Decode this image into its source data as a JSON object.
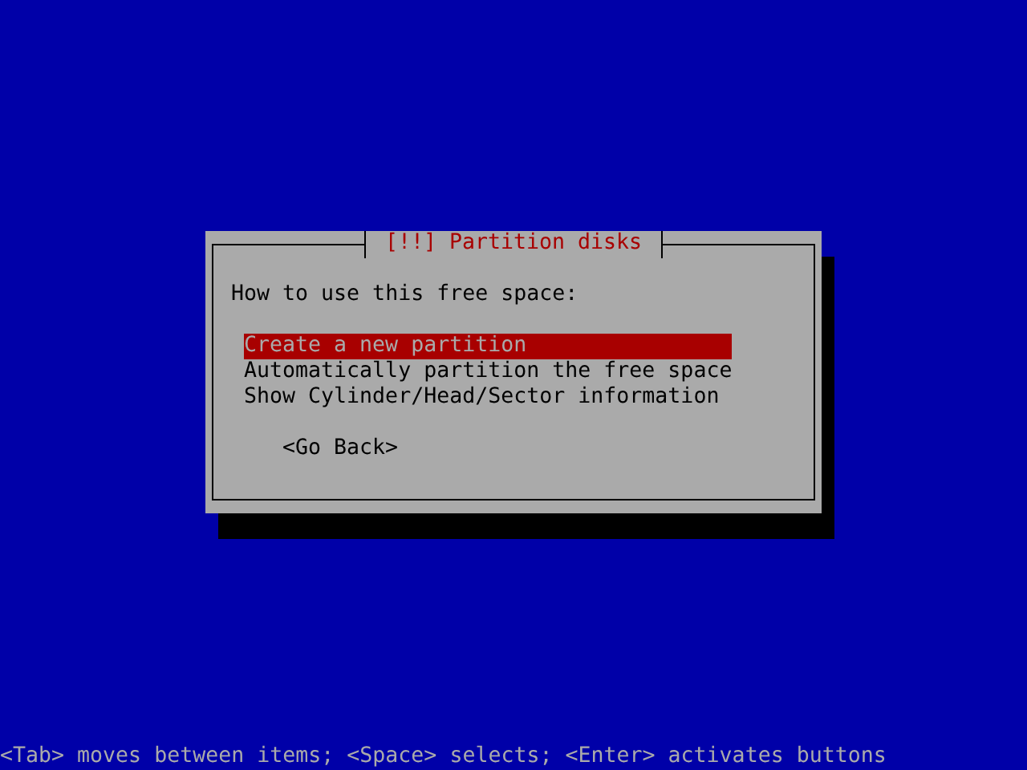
{
  "dialog": {
    "title": "[!!] Partition disks",
    "prompt": "How to use this free space:",
    "options": [
      {
        "label": "Create a new partition",
        "selected": true
      },
      {
        "label": "Automatically partition the free space",
        "selected": false
      },
      {
        "label": "Show Cylinder/Head/Sector information",
        "selected": false
      }
    ],
    "buttons": [
      {
        "label": "<Go Back>"
      }
    ]
  },
  "help_line": "<Tab> moves between items; <Space> selects; <Enter> activates buttons"
}
